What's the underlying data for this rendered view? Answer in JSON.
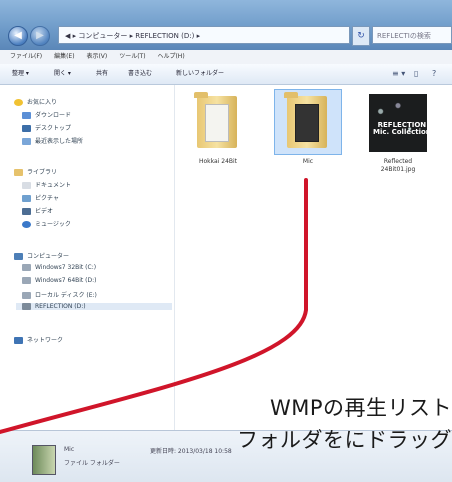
{
  "address": {
    "path": "◀ ▸ コンピューター ▸ REFLECTION (D:) ▸",
    "refresh": "↻",
    "search": "REFLECTIの検索"
  },
  "menu": [
    "ファイル(F)",
    "編集(E)",
    "表示(V)",
    "ツール(T)",
    "ヘルプ(H)"
  ],
  "toolbar": {
    "organize": "整理 ▾",
    "open": "開く ▾",
    "share": "共有",
    "burn": "書き込む",
    "new_folder": "新しいフォルダー",
    "view_icon": "≡ ▾",
    "pane_icon": "▯",
    "help_icon": "?"
  },
  "sidebar": {
    "favorites": {
      "label": "お気に入り",
      "items": [
        "ダウンロード",
        "デスクトップ",
        "最近表示した場所"
      ]
    },
    "libraries": {
      "label": "ライブラリ",
      "items": [
        "ドキュメント",
        "ピクチャ",
        "ビデオ",
        "ミュージック"
      ]
    },
    "computer": {
      "label": "コンピューター",
      "items": [
        "Windows7 32Bit (C:)",
        "Windows7 64Bit (D:)",
        "ローカル ディスク (E:)",
        "REFLECTION (D:)"
      ]
    },
    "network": {
      "label": "ネットワーク"
    }
  },
  "files": [
    {
      "name": "Hokkai 24Bit",
      "type": "folder"
    },
    {
      "name": "Mic",
      "type": "folder"
    },
    {
      "name": "Reflected\n24Bit01.jpg",
      "type": "image",
      "thumb_title": "REFLECTION\nMic. Collection"
    }
  ],
  "status": {
    "name": "Mic",
    "kind": "ファイル フォルダー",
    "date": "更新日時: 2013/03/18 10:58"
  },
  "annotation": {
    "line1": "WMPの再生リスト",
    "line2": "フォルダをにドラッグ"
  },
  "colors": {
    "accent_line": "#d0152a"
  }
}
